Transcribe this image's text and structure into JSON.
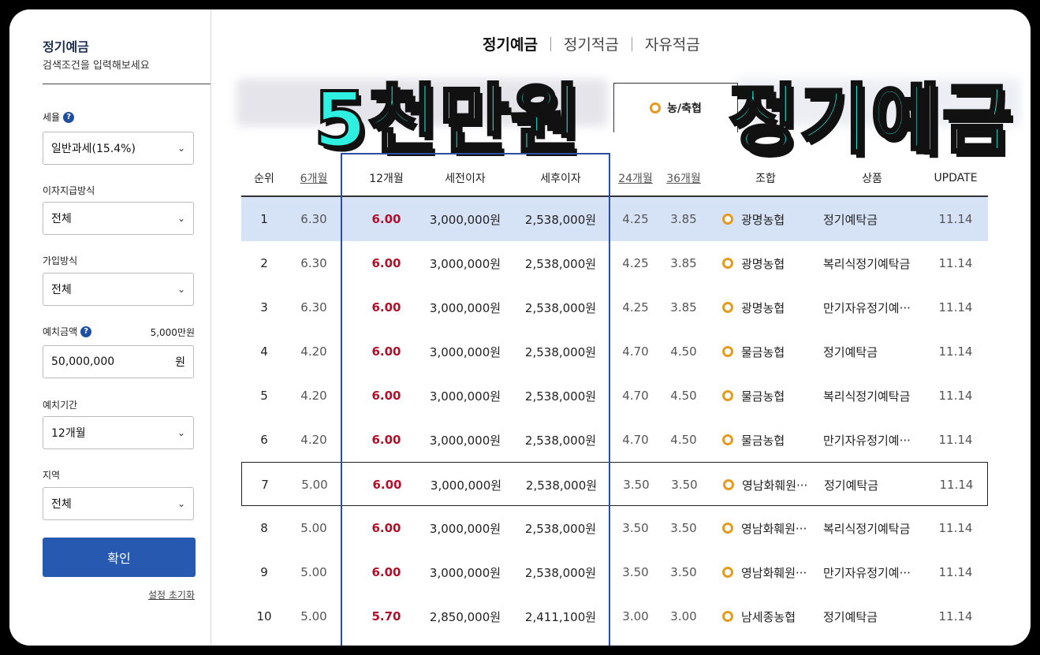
{
  "sidebar": {
    "title": "정기예금",
    "subtitle": "검색조건을 입력해보세요",
    "tax_label": "세율",
    "tax_value": "일반과세(15.4%)",
    "interest_label": "이자지급방식",
    "interest_value": "전체",
    "join_label": "가입방식",
    "join_value": "전체",
    "amount_label": "예치금액",
    "amount_hint": "5,000만원",
    "amount_value": "50,000,000",
    "amount_unit": "원",
    "period_label": "예치기간",
    "period_value": "12개월",
    "region_label": "지역",
    "region_value": "전체",
    "confirm_label": "확인",
    "reset_label": "설정 초기화",
    "help_glyph": "?",
    "chevron": "⌄"
  },
  "tabs": [
    "정기예금",
    "정기적금",
    "자유적금"
  ],
  "sub_tab": "농/축협",
  "overlay": {
    "left": "5천만원",
    "right": "정기예금"
  },
  "table": {
    "headers": {
      "rank": "순위",
      "m6": "6개월",
      "m12": "12개월",
      "pre_tax": "세전이자",
      "post_tax": "세후이자",
      "m24": "24개월",
      "m36": "36개월",
      "bank": "조합",
      "product": "상품",
      "update": "UPDATE"
    },
    "rows": [
      {
        "rank": "1",
        "m6": "6.30",
        "m12": "6.00",
        "pre": "3,000,000원",
        "post": "2,538,000원",
        "m24": "4.25",
        "m36": "3.85",
        "bank": "광명농협",
        "product": "정기예탁금",
        "update": "11.14"
      },
      {
        "rank": "2",
        "m6": "6.30",
        "m12": "6.00",
        "pre": "3,000,000원",
        "post": "2,538,000원",
        "m24": "4.25",
        "m36": "3.85",
        "bank": "광명농협",
        "product": "복리식정기예탁금",
        "update": "11.14"
      },
      {
        "rank": "3",
        "m6": "6.30",
        "m12": "6.00",
        "pre": "3,000,000원",
        "post": "2,538,000원",
        "m24": "4.25",
        "m36": "3.85",
        "bank": "광명농협",
        "product": "만기자유정기예···",
        "update": "11.14"
      },
      {
        "rank": "4",
        "m6": "4.20",
        "m12": "6.00",
        "pre": "3,000,000원",
        "post": "2,538,000원",
        "m24": "4.70",
        "m36": "4.50",
        "bank": "물금농협",
        "product": "정기예탁금",
        "update": "11.14"
      },
      {
        "rank": "5",
        "m6": "4.20",
        "m12": "6.00",
        "pre": "3,000,000원",
        "post": "2,538,000원",
        "m24": "4.70",
        "m36": "4.50",
        "bank": "물금농협",
        "product": "복리식정기예탁금",
        "update": "11.14"
      },
      {
        "rank": "6",
        "m6": "4.20",
        "m12": "6.00",
        "pre": "3,000,000원",
        "post": "2,538,000원",
        "m24": "4.70",
        "m36": "4.50",
        "bank": "물금농협",
        "product": "만기자유정기예···",
        "update": "11.14"
      },
      {
        "rank": "7",
        "m6": "5.00",
        "m12": "6.00",
        "pre": "3,000,000원",
        "post": "2,538,000원",
        "m24": "3.50",
        "m36": "3.50",
        "bank": "영남화훼원···",
        "product": "정기예탁금",
        "update": "11.14"
      },
      {
        "rank": "8",
        "m6": "5.00",
        "m12": "6.00",
        "pre": "3,000,000원",
        "post": "2,538,000원",
        "m24": "3.50",
        "m36": "3.50",
        "bank": "영남화훼원···",
        "product": "복리식정기예탁금",
        "update": "11.14"
      },
      {
        "rank": "9",
        "m6": "5.00",
        "m12": "6.00",
        "pre": "3,000,000원",
        "post": "2,538,000원",
        "m24": "3.50",
        "m36": "3.50",
        "bank": "영남화훼원···",
        "product": "만기자유정기예···",
        "update": "11.14"
      },
      {
        "rank": "10",
        "m6": "5.00",
        "m12": "5.70",
        "pre": "2,850,000원",
        "post": "2,411,100원",
        "m24": "3.00",
        "m36": "3.00",
        "bank": "남세종농협",
        "product": "정기예탁금",
        "update": "11.14"
      }
    ]
  },
  "colors": {
    "accent_blue": "#2859b0",
    "rate_red": "#b3102a",
    "highlight_row": "#d6e3f7",
    "overlay_text": "#2ff0e0"
  }
}
